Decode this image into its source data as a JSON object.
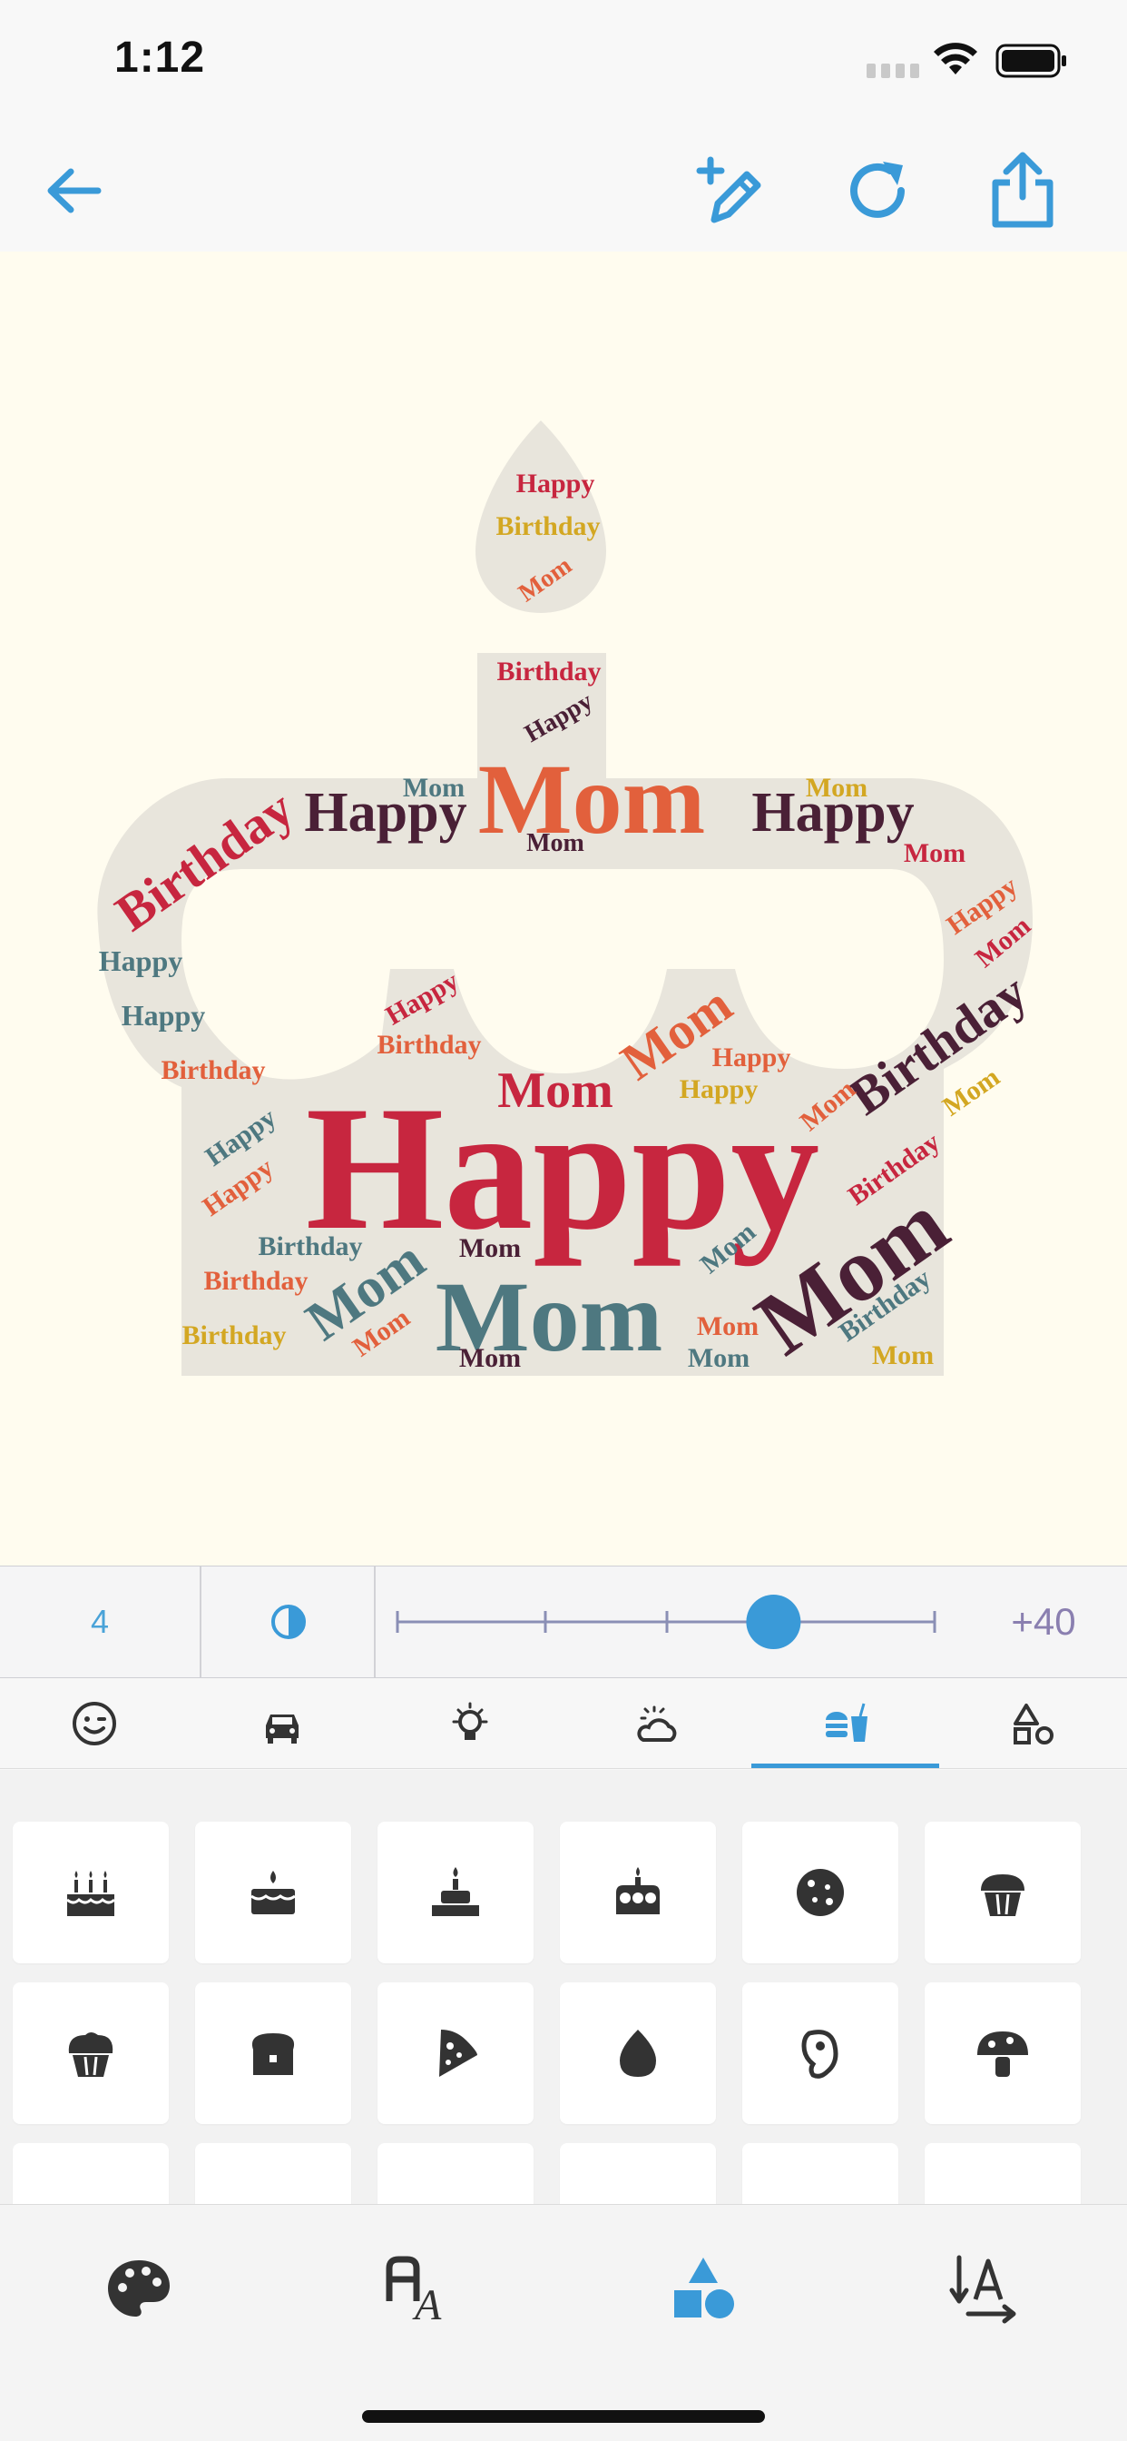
{
  "status_bar": {
    "time": "1:12",
    "icons": [
      "signal-icon",
      "wifi-icon",
      "battery-icon"
    ]
  },
  "toolbar": {
    "buttons": [
      "back-arrow-icon",
      "edit-words-icon",
      "refresh-icon",
      "share-icon"
    ],
    "accent_color": "#3a9ad8"
  },
  "canvas": {
    "background": "#fffcef",
    "shape": "birthday-cake",
    "shape_fill": "#e8e5dc",
    "words": {
      "happy": "Happy",
      "birthday": "Birthday",
      "mom": "Mom"
    },
    "palette": [
      "#c7263f",
      "#e2603c",
      "#d3a722",
      "#4e7880",
      "#4a2036"
    ]
  },
  "adjust_bar": {
    "count": "4",
    "icon": "opacity-drop-icon",
    "slider_fraction": 0.7,
    "value": "+40"
  },
  "category_tabs": {
    "items": [
      "emoji-icon",
      "car-icon",
      "lightbulb-icon",
      "weather-icon",
      "food-icon",
      "shapes-icon"
    ],
    "selected_index": 4
  },
  "shapes": {
    "row1": [
      "birthday-cake-icon",
      "cake-slice-icon",
      "candle-cake-icon",
      "cake-icon",
      "cookie-icon",
      "cupcake-icon"
    ],
    "row2": [
      "muffin-icon",
      "bread-icon",
      "pizza-icon",
      "egg-icon",
      "ham-icon",
      "mushroom-icon"
    ]
  },
  "bottom_tabs": {
    "items": [
      "palette-icon",
      "font-icon",
      "shapes-icon",
      "text-direction-icon"
    ],
    "selected_index": 2
  }
}
